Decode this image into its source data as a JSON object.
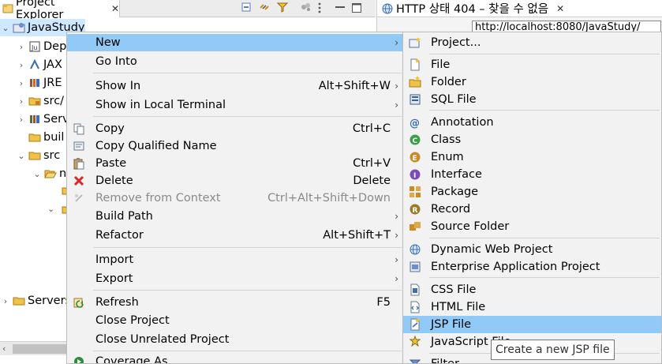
{
  "project_explorer": {
    "tab_label": "Project Explorer",
    "close_glyph": "✕",
    "tree": [
      {
        "label": "JavaStudy",
        "arrow": "⌄",
        "icon": "project-icon",
        "indent": 0
      },
      {
        "label": "Dep",
        "arrow": "›",
        "icon": "deployment-descriptor-icon",
        "indent": 1
      },
      {
        "label": "JAX",
        "arrow": "›",
        "icon": "jax-ws-icon",
        "indent": 1
      },
      {
        "label": "JRE",
        "arrow": "›",
        "icon": "library-icon",
        "indent": 1
      },
      {
        "label": "src/",
        "arrow": "›",
        "icon": "folder-icon",
        "indent": 1
      },
      {
        "label": "Serv",
        "arrow": "›",
        "icon": "library-icon",
        "indent": 1
      },
      {
        "label": "buil",
        "arrow": "",
        "icon": "folder-icon",
        "indent": 1
      },
      {
        "label": "src",
        "arrow": "⌄",
        "icon": "folder-icon",
        "indent": 1
      },
      {
        "label": "n",
        "arrow": "⌄",
        "icon": "folder-icon",
        "indent": 2
      },
      {
        "label": "Servers",
        "arrow": "›",
        "icon": "folder-icon",
        "indent": 0
      }
    ]
  },
  "browser": {
    "tab_title": "HTTP 상태 404 – 찾을 수 없음",
    "close_glyph": "✕",
    "url": "http://localhost:8080/JavaStudy/"
  },
  "context_menu": {
    "items": [
      {
        "label": "New",
        "shortcut": "",
        "submenu": true,
        "icon": "",
        "highlighted": true
      },
      {
        "label": "Go Into",
        "shortcut": "",
        "submenu": false,
        "icon": ""
      },
      {
        "label": "Show In",
        "shortcut": "Alt+Shift+W",
        "submenu": true,
        "icon": ""
      },
      {
        "label": "Show in Local Terminal",
        "shortcut": "",
        "submenu": true,
        "icon": ""
      },
      {
        "label": "Copy",
        "shortcut": "Ctrl+C",
        "submenu": false,
        "icon": "copy-icon"
      },
      {
        "label": "Copy Qualified Name",
        "shortcut": "",
        "submenu": false,
        "icon": "copy-qualified-icon"
      },
      {
        "label": "Paste",
        "shortcut": "Ctrl+V",
        "submenu": false,
        "icon": "paste-icon"
      },
      {
        "label": "Delete",
        "shortcut": "Delete",
        "submenu": false,
        "icon": "delete-icon"
      },
      {
        "label": "Remove from Context",
        "shortcut": "Ctrl+Alt+Shift+Down",
        "submenu": false,
        "icon": "remove-context-icon",
        "disabled": true
      },
      {
        "label": "Build Path",
        "shortcut": "",
        "submenu": true,
        "icon": ""
      },
      {
        "label": "Refactor",
        "shortcut": "Alt+Shift+T",
        "submenu": true,
        "icon": ""
      },
      {
        "label": "Import",
        "shortcut": "",
        "submenu": true,
        "icon": ""
      },
      {
        "label": "Export",
        "shortcut": "",
        "submenu": true,
        "icon": ""
      },
      {
        "label": "Refresh",
        "shortcut": "F5",
        "submenu": false,
        "icon": "refresh-icon"
      },
      {
        "label": "Close Project",
        "shortcut": "",
        "submenu": false,
        "icon": ""
      },
      {
        "label": "Close Unrelated Project",
        "shortcut": "",
        "submenu": false,
        "icon": ""
      },
      {
        "label": "Coverage As",
        "shortcut": "",
        "submenu": false,
        "icon": "coverage-icon"
      }
    ]
  },
  "new_submenu": {
    "items": [
      {
        "label": "Project...",
        "icon": "new-project-icon"
      },
      {
        "label": "File",
        "icon": "new-file-icon"
      },
      {
        "label": "Folder",
        "icon": "new-folder-icon"
      },
      {
        "label": "SQL File",
        "icon": "sql-file-icon"
      },
      {
        "label": "Annotation",
        "icon": "annotation-icon"
      },
      {
        "label": "Class",
        "icon": "class-icon"
      },
      {
        "label": "Enum",
        "icon": "enum-icon"
      },
      {
        "label": "Interface",
        "icon": "interface-icon"
      },
      {
        "label": "Package",
        "icon": "package-icon"
      },
      {
        "label": "Record",
        "icon": "record-icon"
      },
      {
        "label": "Source Folder",
        "icon": "source-folder-icon"
      },
      {
        "label": "Dynamic Web Project",
        "icon": "dynamic-web-project-icon"
      },
      {
        "label": "Enterprise Application Project",
        "icon": "enterprise-app-project-icon"
      },
      {
        "label": "CSS File",
        "icon": "css-file-icon"
      },
      {
        "label": "HTML File",
        "icon": "html-file-icon"
      },
      {
        "label": "JSP File",
        "icon": "jsp-file-icon",
        "highlighted": true
      },
      {
        "label": "JavaScript File",
        "icon": "javascript-file-icon"
      },
      {
        "label": "Filter",
        "icon": "filter-icon"
      }
    ]
  },
  "tooltip": {
    "text": "Create a new JSP file"
  },
  "colors": {
    "highlight": "#91c9f7",
    "menu_bg": "#f2f2f2",
    "selection": "#cde8ff",
    "delete_red": "#d9262b"
  }
}
